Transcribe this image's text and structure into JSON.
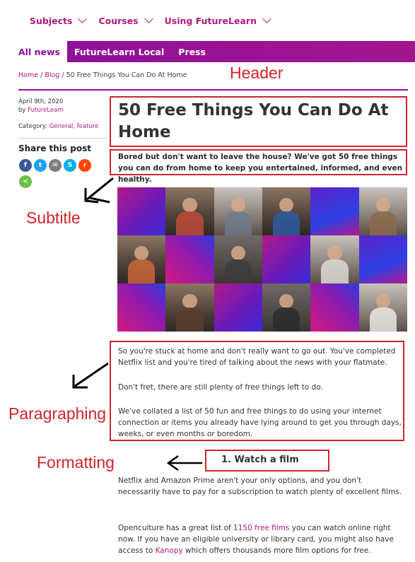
{
  "topnav": {
    "items": [
      {
        "label": "Subjects"
      },
      {
        "label": "Courses"
      },
      {
        "label": "Using FutureLearn"
      }
    ]
  },
  "subnav": {
    "tabs": [
      {
        "label": "All news",
        "active": true
      },
      {
        "label": "FutureLearn Local",
        "active": false
      },
      {
        "label": "Press",
        "active": false
      }
    ]
  },
  "breadcrumb": {
    "home": "Home",
    "sep1": " / ",
    "blog": "Blog",
    "sep2": " / ",
    "current": "50 Free Things You Can Do At Home"
  },
  "meta": {
    "date": "April 9th, 2020",
    "by_prefix": "by ",
    "author": "FutureLearn",
    "category_prefix": "Category: ",
    "categories": "General, feature"
  },
  "share": {
    "title": "Share this post",
    "buttons": [
      {
        "icon": "facebook-icon",
        "glyph": "f",
        "color": "#3b5998"
      },
      {
        "icon": "twitter-icon",
        "glyph": "t",
        "color": "#1da1f2"
      },
      {
        "icon": "email-icon",
        "glyph": "✉",
        "color": "#7d7d7d"
      },
      {
        "icon": "skype-icon",
        "glyph": "S",
        "color": "#00aff0"
      },
      {
        "icon": "reddit-icon",
        "glyph": "r",
        "color": "#ff4500"
      },
      {
        "icon": "share-icon",
        "glyph": "<",
        "color": "#6cc04a"
      }
    ]
  },
  "article": {
    "title": "50 Free Things You Can Do At Home",
    "subtitle": "Bored but don't want to leave the house? We've got 50 free things you can do from home to keep you entertained, informed, and even healthy.",
    "paragraphs": [
      "So you're stuck at home and don't really want to go out. You've completed Netflix list and you're tired of talking about the news with your flatmate.",
      "Don't fret, there are still plenty of free things left to do.",
      "We've collated a list of 50 fun and free things to do using your internet connection or items you already have lying around to get you through days, weeks, or even months or boredom."
    ],
    "heading": "1. Watch a film",
    "p_after_1": "Netflix and Amazon Prime aren't your only options, and you don't necessarily have to pay for a subscription to watch plenty of excellent films.",
    "p_after_2_a": "Openculture has a great list of ",
    "p_after_2_link1": "1150 free films",
    "p_after_2_b": " you can watch online right now. If you have an eligible university or library card, you might also have access to ",
    "p_after_2_link2": "Kanopy",
    "p_after_2_c": " which offers thousands more film options for free."
  },
  "annotations": {
    "header": "Header",
    "subtitle": "Subtitle",
    "paragraphing": "Paragraphing",
    "formatting": "Formatting",
    "color": "#d2232a"
  }
}
